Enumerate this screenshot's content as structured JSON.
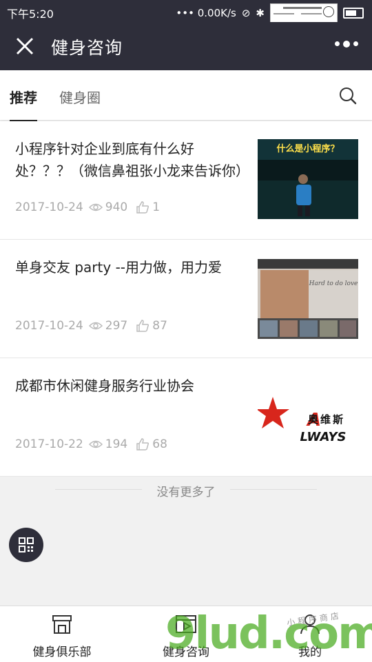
{
  "status_bar": {
    "time": "下午5:20",
    "network": "••• 0.00K/s"
  },
  "nav": {
    "title": "健身咨询"
  },
  "tabs": [
    {
      "label": "推荐",
      "active": true
    },
    {
      "label": "健身圈",
      "active": false
    }
  ],
  "articles": [
    {
      "title": "小程序针对企业到底有什么好处？？？（微信鼻祖张小龙来告诉你）",
      "date": "2017-10-24",
      "views": "940",
      "likes": "1",
      "image_text": "什么是小程序？"
    },
    {
      "title": "单身交友 party --用力做，用力爱",
      "date": "2017-10-24",
      "views": "297",
      "likes": "87",
      "image_text": "Hard to do love"
    },
    {
      "title": "成都市休闲健身服务行业协会",
      "date": "2017-10-22",
      "views": "194",
      "likes": "68",
      "image_text": "奥维斯",
      "image_text2": "LWAYS"
    }
  ],
  "no_more_text": "没有更多了",
  "bottom_tabs": [
    {
      "label": "健身俱乐部",
      "icon": "store-icon"
    },
    {
      "label": "健身咨询",
      "icon": "news-icon"
    },
    {
      "label": "我的",
      "icon": "user-icon"
    }
  ],
  "watermark": {
    "big": "9lud.com",
    "small": "小程序商店"
  },
  "colors": {
    "header_bg": "#2e2e3a",
    "watermark_green": "#48aa1e"
  }
}
